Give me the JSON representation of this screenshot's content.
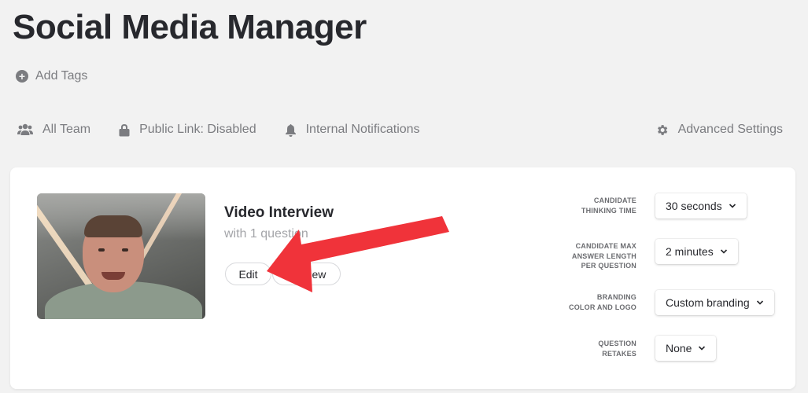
{
  "page": {
    "title": "Social Media Manager"
  },
  "tags": {
    "add_label": "Add Tags"
  },
  "toolbar": {
    "team_label": "All Team",
    "public_link_label": "Public Link: Disabled",
    "notifications_label": "Internal Notifications",
    "advanced_label": "Advanced Settings"
  },
  "card": {
    "title": "Video Interview",
    "subtitle": "with 1 question",
    "edit_label": "Edit",
    "preview_label": "Preview"
  },
  "settings": [
    {
      "label_lines": [
        "CANDIDATE",
        "THINKING TIME"
      ],
      "value": "30 seconds"
    },
    {
      "label_lines": [
        "CANDIDATE MAX",
        "ANSWER LENGTH",
        "PER QUESTION"
      ],
      "value": "2 minutes"
    },
    {
      "label_lines": [
        "BRANDING",
        "COLOR AND LOGO"
      ],
      "value": "Custom branding"
    },
    {
      "label_lines": [
        "QUESTION",
        "RETAKES"
      ],
      "value": "None"
    }
  ],
  "colors": {
    "background": "#f2f2f2",
    "card": "#ffffff",
    "text": "#27282d",
    "muted": "#7b7c80",
    "annotation_arrow": "#f0333a"
  },
  "icons": {
    "add": "plus-circle-icon",
    "team": "users-icon",
    "public_link": "lock-icon",
    "notifications": "bell-icon",
    "advanced": "gear-icon",
    "dropdown": "chevron-down-icon"
  }
}
